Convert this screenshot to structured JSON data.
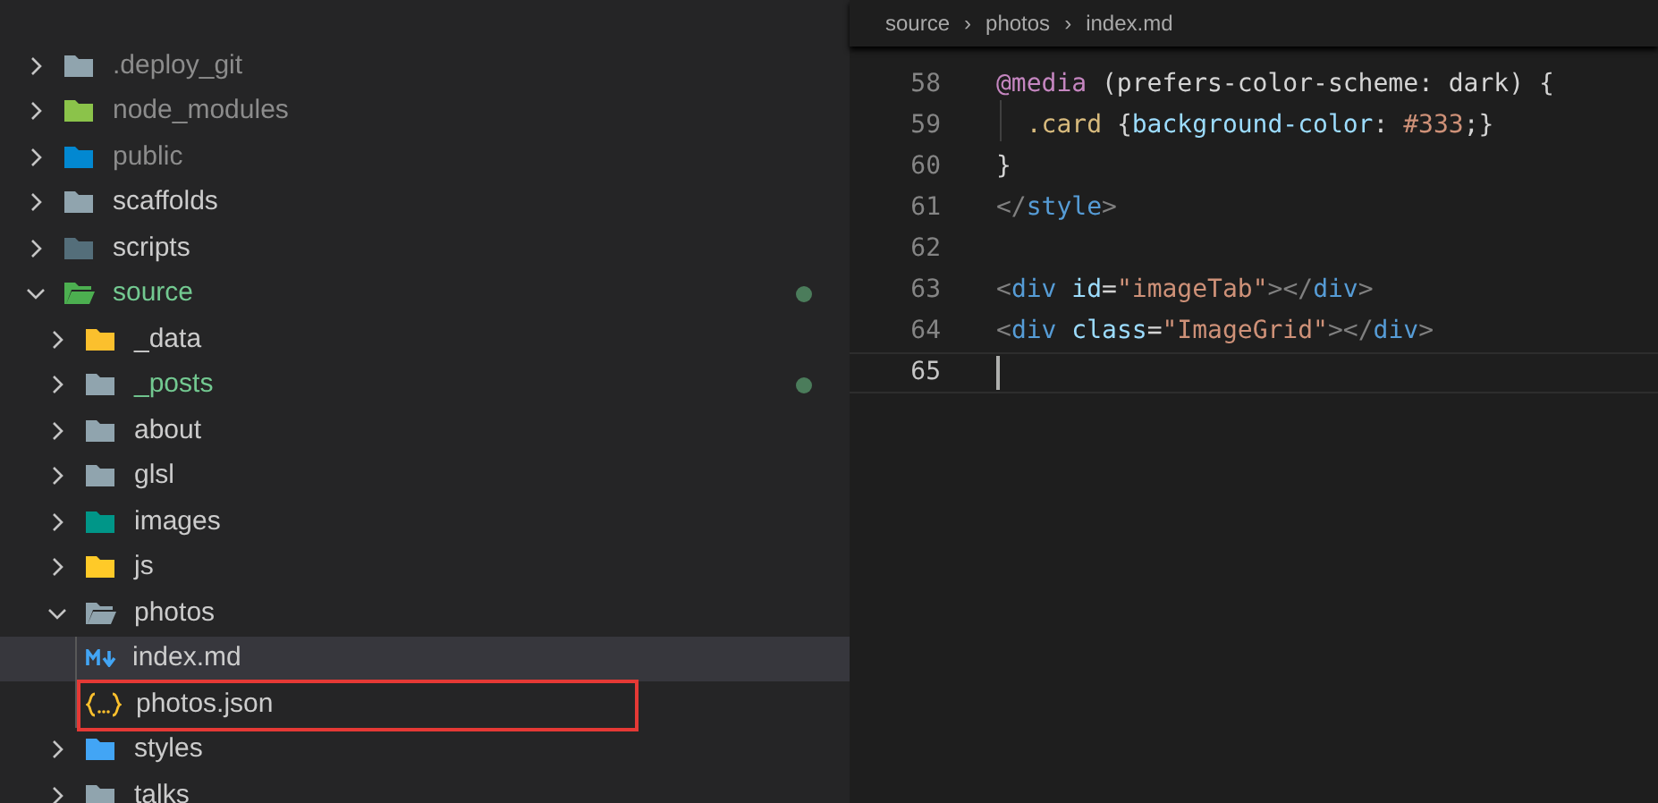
{
  "explorer": {
    "items": [
      {
        "label": ".deploy_git",
        "kind": "folder",
        "color": "#90a4ae",
        "expanded": false,
        "ignored": true,
        "modified": false
      },
      {
        "label": "node_modules",
        "kind": "folder",
        "color": "#8bc34a",
        "expanded": false,
        "ignored": true,
        "modified": false
      },
      {
        "label": "public",
        "kind": "folder",
        "color": "#0288d1",
        "expanded": false,
        "ignored": true,
        "modified": false
      },
      {
        "label": "scaffolds",
        "kind": "folder",
        "color": "#90a4ae",
        "expanded": false,
        "ignored": false,
        "modified": false
      },
      {
        "label": "scripts",
        "kind": "folder",
        "color": "#546e7a",
        "expanded": false,
        "ignored": false,
        "modified": false
      },
      {
        "label": "source",
        "kind": "folder",
        "color": "#4caf50",
        "expanded": true,
        "ignored": false,
        "modified": true,
        "children": [
          {
            "label": "_data",
            "kind": "folder",
            "color": "#fbc02d",
            "expanded": false,
            "ignored": false,
            "modified": false
          },
          {
            "label": "_posts",
            "kind": "folder",
            "color": "#90a4ae",
            "expanded": false,
            "ignored": false,
            "modified": true
          },
          {
            "label": "about",
            "kind": "folder",
            "color": "#90a4ae",
            "expanded": false,
            "ignored": false,
            "modified": false
          },
          {
            "label": "glsl",
            "kind": "folder",
            "color": "#90a4ae",
            "expanded": false,
            "ignored": false,
            "modified": false
          },
          {
            "label": "images",
            "kind": "folder",
            "color": "#009688",
            "expanded": false,
            "ignored": false,
            "modified": false
          },
          {
            "label": "js",
            "kind": "folder",
            "color": "#ffca28",
            "expanded": false,
            "ignored": false,
            "modified": false
          },
          {
            "label": "photos",
            "kind": "folder",
            "color": "#90a4ae",
            "expanded": true,
            "ignored": false,
            "modified": false,
            "children": [
              {
                "label": "index.md",
                "kind": "markdown",
                "selected": true,
                "outlined": false
              },
              {
                "label": "photos.json",
                "kind": "json",
                "selected": false,
                "outlined": true
              }
            ]
          },
          {
            "label": "styles",
            "kind": "folder",
            "color": "#42a5f5",
            "expanded": false,
            "ignored": false,
            "modified": false
          },
          {
            "label": "talks",
            "kind": "folder",
            "color": "#90a4ae",
            "expanded": false,
            "ignored": false,
            "modified": false
          }
        ]
      }
    ]
  },
  "editor": {
    "breadcrumbs": [
      {
        "label": "source",
        "separator": "›"
      },
      {
        "label": "photos",
        "separator": "›"
      },
      {
        "label": "index.md"
      }
    ],
    "lines": [
      {
        "number": "58",
        "current": false,
        "tokens": [
          {
            "text": "@media",
            "color": "#c586c0"
          },
          {
            "text": " (prefers-color-scheme: dark) {",
            "color": "#d4d4d4"
          }
        ]
      },
      {
        "number": "59",
        "current": false,
        "guide": true,
        "tokens": [
          {
            "text": "  .card",
            "color": "#d7ba7d"
          },
          {
            "text": " {",
            "color": "#d4d4d4"
          },
          {
            "text": "background-color",
            "color": "#9cdcfe"
          },
          {
            "text": ": ",
            "color": "#d4d4d4"
          },
          {
            "text": "#333",
            "color": "#ce9178"
          },
          {
            "text": ";}",
            "color": "#d4d4d4"
          }
        ]
      },
      {
        "number": "60",
        "current": false,
        "tokens": [
          {
            "text": "}",
            "color": "#d4d4d4"
          }
        ]
      },
      {
        "number": "61",
        "current": false,
        "tokens": [
          {
            "text": "</",
            "color": "#808080"
          },
          {
            "text": "style",
            "color": "#569cd6"
          },
          {
            "text": ">",
            "color": "#808080"
          }
        ]
      },
      {
        "number": "62",
        "current": false
      },
      {
        "number": "63",
        "current": false,
        "tokens": [
          {
            "text": "<",
            "color": "#808080"
          },
          {
            "text": "div",
            "color": "#569cd6"
          },
          {
            "text": " id",
            "color": "#9cdcfe"
          },
          {
            "text": "=",
            "color": "#d4d4d4"
          },
          {
            "text": "\"imageTab\"",
            "color": "#ce9178"
          },
          {
            "text": "></",
            "color": "#808080"
          },
          {
            "text": "div",
            "color": "#569cd6"
          },
          {
            "text": ">",
            "color": "#808080"
          }
        ]
      },
      {
        "number": "64",
        "current": false,
        "tokens": [
          {
            "text": "<",
            "color": "#808080"
          },
          {
            "text": "div",
            "color": "#569cd6"
          },
          {
            "text": " class",
            "color": "#9cdcfe"
          },
          {
            "text": "=",
            "color": "#d4d4d4"
          },
          {
            "text": "\"ImageGrid\"",
            "color": "#ce9178"
          },
          {
            "text": "></",
            "color": "#808080"
          },
          {
            "text": "div",
            "color": "#569cd6"
          },
          {
            "text": ">",
            "color": "#808080"
          }
        ]
      },
      {
        "number": "65",
        "current": true
      }
    ]
  }
}
